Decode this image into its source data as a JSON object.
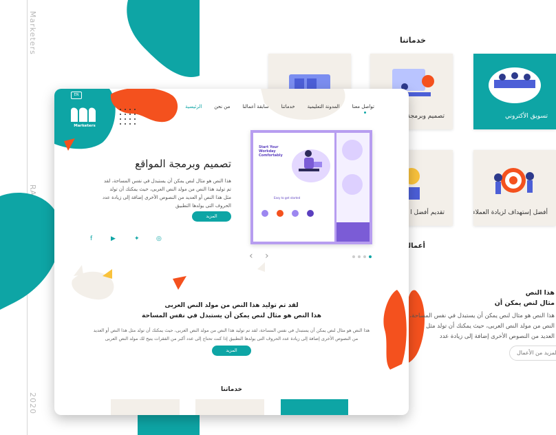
{
  "side": {
    "brand": "Marketers",
    "author": "RANIA ELBANNY",
    "year": "2020"
  },
  "colors": {
    "teal": "#0ea5a5",
    "orange": "#f4511e",
    "yellow": "#f9c23c",
    "purple": "#7b5cd6",
    "beige": "#f3efe9"
  },
  "back": {
    "services_title": "خدماتنا",
    "cards": [
      {
        "label": "تسويق الأكتروني",
        "teal": true
      },
      {
        "label": "تصميم وبرمجة",
        "teal": false
      },
      {
        "label": "",
        "teal": false
      },
      {
        "label": "أفضل إستهداف لزيادة العملاء",
        "teal": false
      },
      {
        "label": "تقديم أفضل ا",
        "teal": false
      }
    ],
    "works_title": "أعمالـ",
    "text_title_1": "هذا النص",
    "text_title_2": "مثال لنص يمكن أن",
    "text_lines": [
      "هذا النص هو مثال لنص يمكن أن يستبدل في نفس المساحة، لقد",
      "النص من مولد النص العربى، حيث يمكنك أن تولد مثل",
      "العديد من النصوص الأخرى إضافة إلى زيادة عدد"
    ],
    "more_works": "المزيد من الأعمال"
  },
  "front": {
    "logo_text": "Marketers",
    "lang_badge": "EN",
    "nav": [
      "الرئيسية",
      "من نحن",
      "سابقة أعمالنا",
      "خدماتنا",
      "المدونة التعليمية",
      "تواصل معنا"
    ],
    "hero": {
      "title": "تصميم وبرمجة المواقع",
      "text": "هذا النص هو مثال لنص يمكن أن يستبدل في نفس المساحة، لقد تم توليد هذا النص من مولد النص العربى، حيث يمكنك أن تولد مثل هذا النص أو العديد من النصوص الأخرى إضافة إلى زيادة عدد الحروف التى يولدها التطبيق",
      "button": "المزيد"
    },
    "mockup": {
      "headline_1": "Start Your",
      "headline_2": "Workday",
      "headline_3": "Comfortably",
      "sub": "Easy to get started"
    },
    "section": {
      "line1": "لقد تم توليد هذا النص من مولد النص العربى",
      "line2": "هذا النص هو مثال لنص يمكن أن يستبدل في نفس المساحة",
      "para": "هذا النص هو مثال لنص يمكن أن يستبدل في نفس المساحة، لقد تم توليد هذا النص من مولد النص العربى، حيث يمكنك أن تولد مثل هذا النص أو العديد من النصوص الأخرى إضافة إلى زيادة عدد الحروف التى يولدها التطبيق إذا كنت تحتاج إلى عدد أكبر من الفقرات يتيح لك مولد النص العربى",
      "button": "المزيد"
    },
    "services_title": "خدماتنا"
  }
}
